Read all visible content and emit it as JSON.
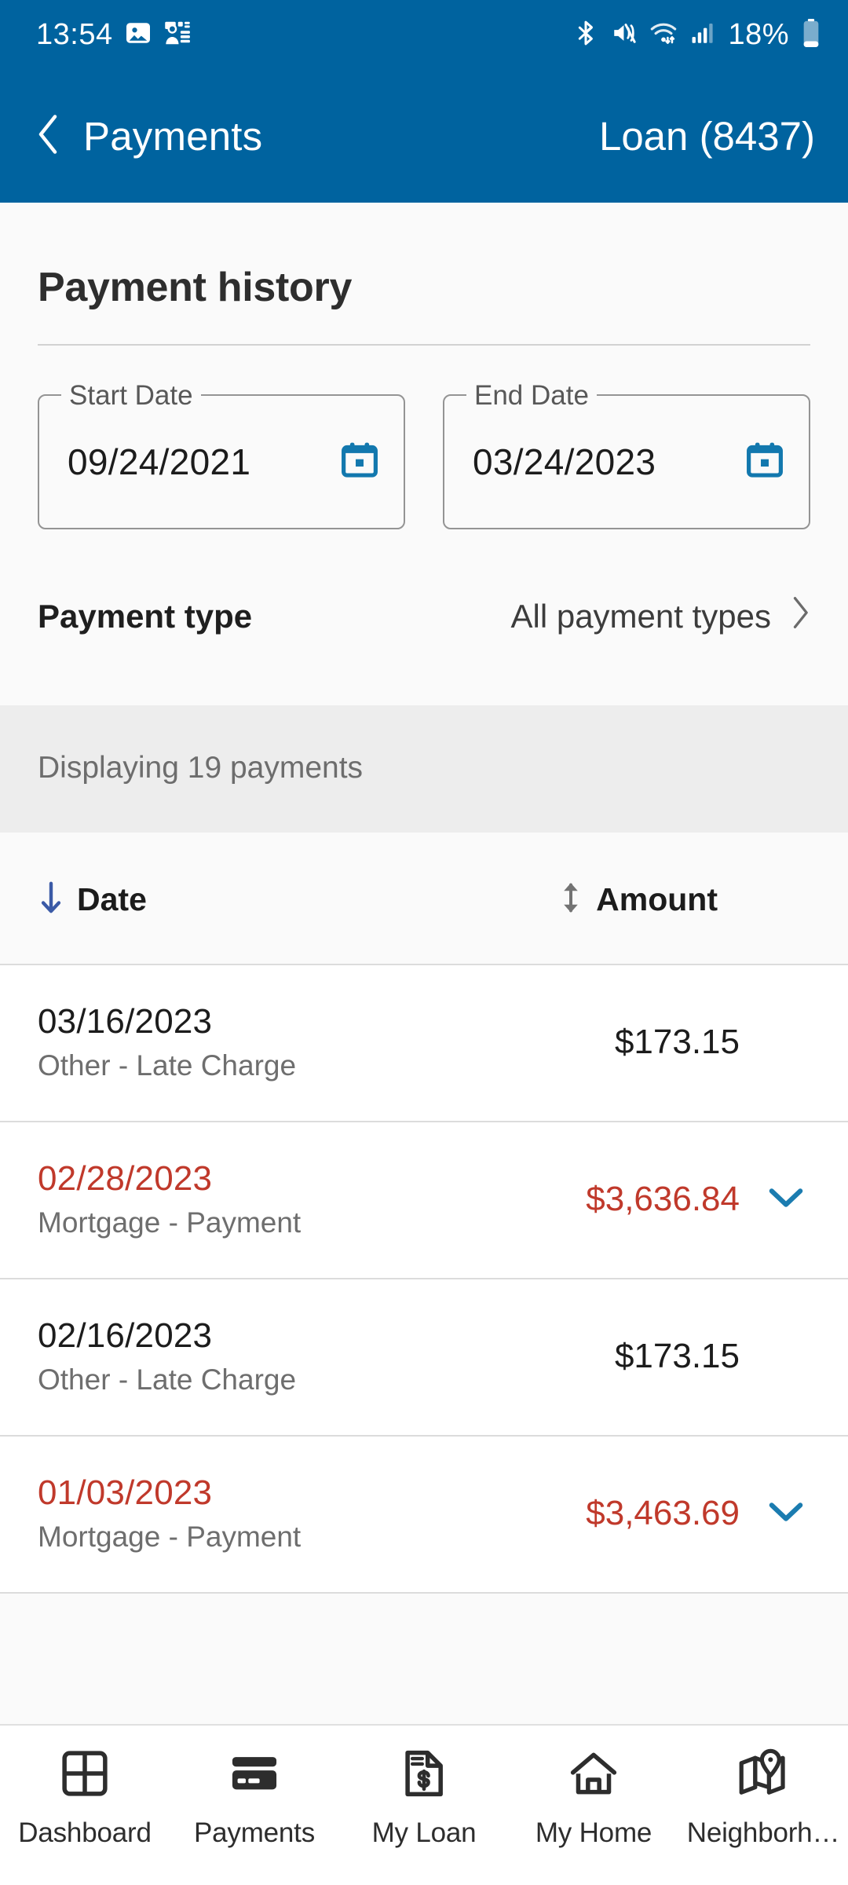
{
  "status_bar": {
    "time": "13:54",
    "battery_percent": "18%",
    "left_icons": [
      "photo-icon",
      "contacts-card-icon"
    ],
    "right_icons": [
      "bluetooth-icon",
      "mute-vibrate-icon",
      "wifi-icon",
      "cellular-signal-icon",
      "battery-icon"
    ]
  },
  "app_bar": {
    "back_icon": "chevron-left-icon",
    "back_label": "Payments",
    "account_label": "Loan (8437)",
    "background_color": "#00639f"
  },
  "page": {
    "title": "Payment history"
  },
  "filters": {
    "start_date": {
      "legend": "Start Date",
      "value": "09/24/2021",
      "icon": "calendar-icon"
    },
    "end_date": {
      "legend": "End Date",
      "value": "03/24/2023",
      "icon": "calendar-icon"
    },
    "payment_type": {
      "label": "Payment type",
      "value": "All payment types",
      "icon": "chevron-right-icon"
    }
  },
  "results_banner": {
    "text": "Displaying 19 payments"
  },
  "table": {
    "columns": [
      {
        "label": "Date",
        "sort_icon": "arrow-down-icon",
        "sort_state": "descending",
        "icon_color": "#3b5aa6"
      },
      {
        "label": "Amount",
        "sort_icon": "arrow-up-down-icon",
        "sort_state": "unsorted",
        "icon_color": "#737373"
      }
    ],
    "rows": [
      {
        "date": "03/16/2023",
        "type": "Other - Late Charge",
        "amount": "$173.15",
        "alert": false,
        "expandable": false
      },
      {
        "date": "02/28/2023",
        "type": "Mortgage - Payment",
        "amount": "$3,636.84",
        "alert": true,
        "expandable": true
      },
      {
        "date": "02/16/2023",
        "type": "Other - Late Charge",
        "amount": "$173.15",
        "alert": false,
        "expandable": false
      },
      {
        "date": "01/03/2023",
        "type": "Mortgage - Payment",
        "amount": "$3,463.69",
        "alert": true,
        "expandable": true
      }
    ]
  },
  "bottom_nav": {
    "items": [
      {
        "label": "Dashboard",
        "icon": "dashboard-grid-icon"
      },
      {
        "label": "Payments",
        "icon": "credit-card-icon"
      },
      {
        "label": "My Loan",
        "icon": "document-dollar-icon"
      },
      {
        "label": "My Home",
        "icon": "house-icon"
      },
      {
        "label": "Neighborh…",
        "icon": "map-pin-icon"
      }
    ]
  },
  "colors": {
    "header_blue": "#00639f",
    "accent_blue": "#1b7cb0",
    "alert_red": "#c0392b",
    "banner_gray": "#ededed",
    "page_bg": "#fafafa"
  }
}
